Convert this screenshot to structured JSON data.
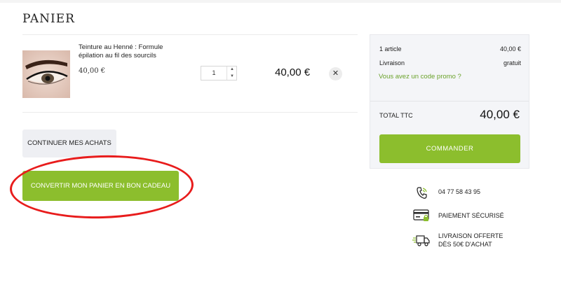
{
  "page": {
    "title": "PANIER"
  },
  "cart": {
    "item": {
      "name": "Teinture au Henné : Formule épilation au fil des sourcils",
      "unit_price": "40,00 €",
      "quantity": "1",
      "line_total": "40,00 €",
      "remove_icon": "close-icon"
    },
    "continue_label": "CONTINUER MES ACHATS",
    "gift_label": "CONVERTIR MON PANIER EN BON CADEAU"
  },
  "summary": {
    "articles_label": "1 article",
    "articles_value": "40,00 €",
    "shipping_label": "Livraison",
    "shipping_value": "gratuit",
    "promo_link": "Vous avez un code promo ?",
    "total_label": "TOTAL TTC",
    "total_value": "40,00 €",
    "order_button": "COMMANDER"
  },
  "reassurance": {
    "phone": "04 77 58 43 95",
    "payment": "PAIEMENT SÉCURISÉ",
    "delivery_line1": "LIVRAISON OFFERTE",
    "delivery_line2": "DÈS 50€ D'ACHAT"
  },
  "colors": {
    "accent_green": "#8cbe2d",
    "promo_green": "#6aa22a",
    "annotation_red": "#e81c1c"
  }
}
